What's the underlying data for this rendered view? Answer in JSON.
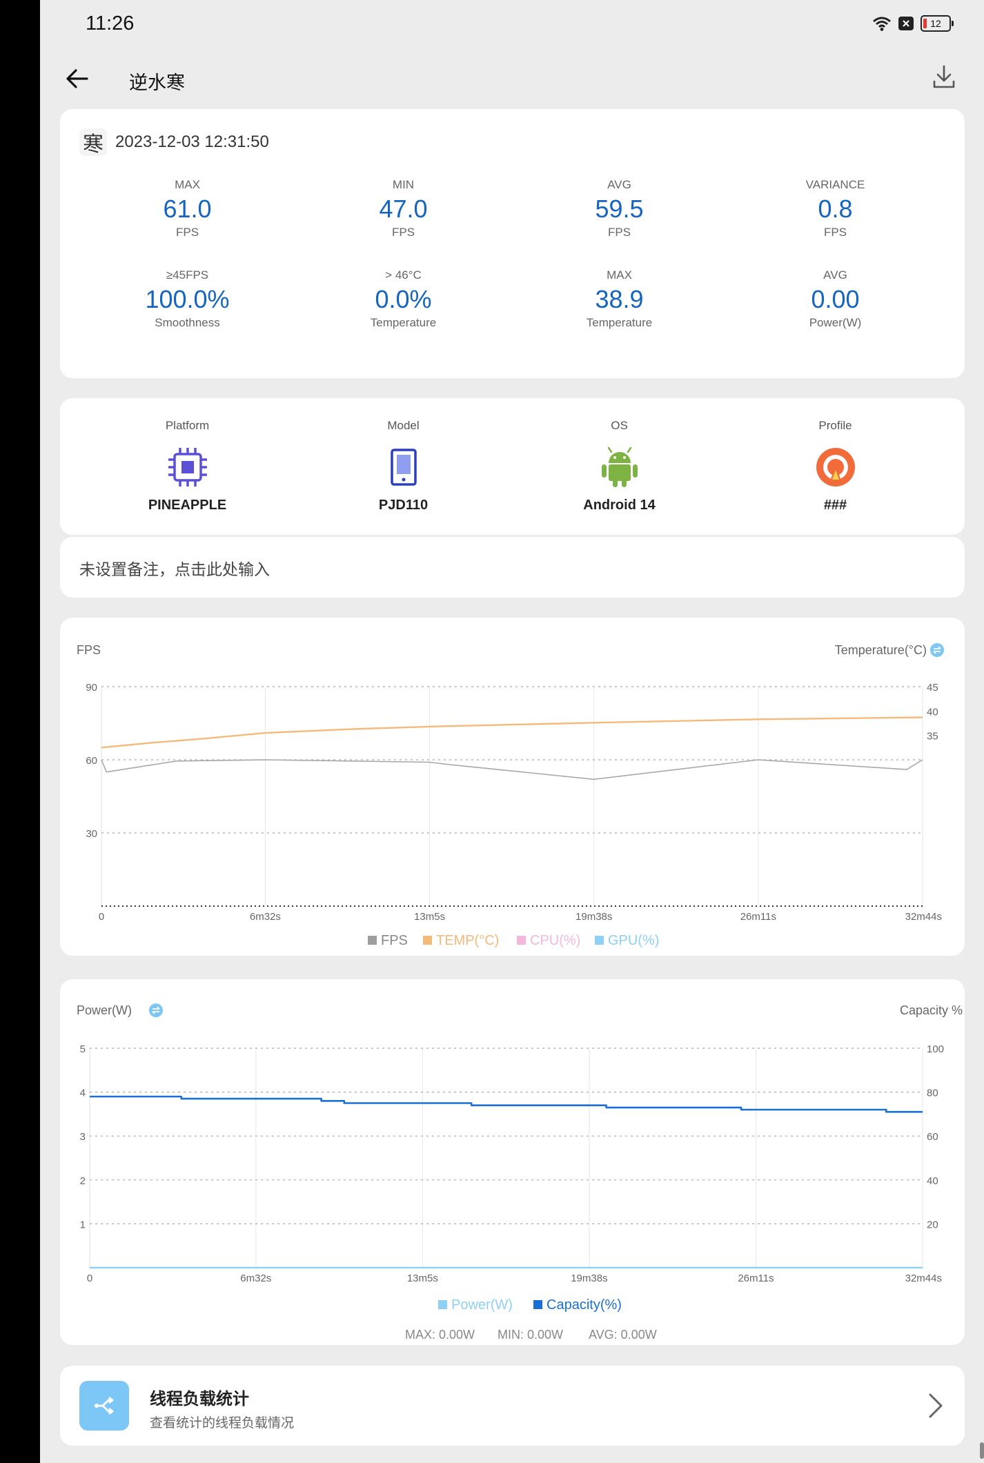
{
  "status_bar": {
    "time": "11:26",
    "battery": "12"
  },
  "app_bar": {
    "title": "逆水寒"
  },
  "session": {
    "game_icon_char": "寒",
    "timestamp": "2023-12-03 12:31:50",
    "stats": [
      {
        "top": "MAX",
        "value": "61.0",
        "bottom": "FPS"
      },
      {
        "top": "MIN",
        "value": "47.0",
        "bottom": "FPS"
      },
      {
        "top": "AVG",
        "value": "59.5",
        "bottom": "FPS"
      },
      {
        "top": "VARIANCE",
        "value": "0.8",
        "bottom": "FPS"
      },
      {
        "top": "≥45FPS",
        "value": "100.0%",
        "bottom": "Smoothness"
      },
      {
        "top": "> 46°C",
        "value": "0.0%",
        "bottom": "Temperature"
      },
      {
        "top": "MAX",
        "value": "38.9",
        "bottom": "Temperature"
      },
      {
        "top": "AVG",
        "value": "0.00",
        "bottom": "Power(W)"
      }
    ]
  },
  "device": {
    "items": [
      {
        "label": "Platform",
        "value": "PINEAPPLE",
        "icon": "chip-icon"
      },
      {
        "label": "Model",
        "value": "PJD110",
        "icon": "tablet-icon"
      },
      {
        "label": "OS",
        "value": "Android 14",
        "icon": "android-icon"
      },
      {
        "label": "Profile",
        "value": "###",
        "icon": "profile-icon"
      }
    ]
  },
  "note": {
    "placeholder": "未设置备注，点击此处输入"
  },
  "colors": {
    "accent": "#1565c0",
    "fps": "#9e9e9e",
    "temp": "#f5b97a",
    "cpu": "#f5b8dc",
    "gpu": "#8fd0f5",
    "power": "#8fd0f5",
    "capacity": "#1a6fd6"
  },
  "chart_data": [
    {
      "type": "line",
      "left_axis_label": "FPS",
      "right_axis_label": "Temperature(°C)",
      "x_ticks": [
        "0",
        "6m32s",
        "13m5s",
        "19m38s",
        "26m11s",
        "32m44s"
      ],
      "x_minutes": [
        0,
        6.53,
        13.08,
        19.63,
        26.18,
        32.73
      ],
      "y_left_ticks": [
        "90",
        "60",
        "30"
      ],
      "y_left_range": [
        0,
        90
      ],
      "y_right_ticks": [
        "45",
        "40",
        "35"
      ],
      "y_right_range": [
        0,
        45
      ],
      "legend": [
        "FPS",
        "TEMP(°C)",
        "CPU(%)",
        "GPU(%)"
      ],
      "series": [
        {
          "name": "FPS",
          "x": [
            0,
            0.2,
            3,
            6.53,
            13.08,
            13.9,
            19.63,
            26.18,
            32.1,
            32.73
          ],
          "y": [
            60,
            55,
            59.5,
            60,
            59,
            58,
            52,
            60,
            56,
            60
          ]
        },
        {
          "name": "TEMP(°C)",
          "x": [
            0,
            2,
            4,
            6.53,
            10,
            13.08,
            19.63,
            26.18,
            32.73
          ],
          "y": [
            32.5,
            33.5,
            34.3,
            35.5,
            36.3,
            36.8,
            37.6,
            38.3,
            38.7
          ]
        },
        {
          "name": "CPU(%)",
          "x": [],
          "y": []
        },
        {
          "name": "GPU(%)",
          "x": [],
          "y": []
        }
      ],
      "grid": true,
      "legend_position": "bottom"
    },
    {
      "type": "line",
      "left_axis_label": "Power(W)",
      "right_axis_label": "Capacity %",
      "x_ticks": [
        "0",
        "6m32s",
        "13m5s",
        "19m38s",
        "26m11s",
        "32m44s"
      ],
      "x_minutes": [
        0,
        6.53,
        13.08,
        19.63,
        26.18,
        32.73
      ],
      "y_left_ticks": [
        "5",
        "4",
        "3",
        "2",
        "1"
      ],
      "y_left_range": [
        0,
        5
      ],
      "y_right_ticks": [
        "100",
        "80",
        "60",
        "40",
        "20"
      ],
      "y_right_range": [
        0,
        100
      ],
      "legend": [
        "Power(W)",
        "Capacity(%)"
      ],
      "series": [
        {
          "name": "Power(W)",
          "x": [
            0,
            32.73
          ],
          "y": [
            0,
            0
          ]
        },
        {
          "name": "Capacity(%)",
          "x": [
            0,
            3.6,
            3.6,
            9.1,
            9.1,
            10,
            10,
            15,
            15,
            20.3,
            20.3,
            25.6,
            25.6,
            31.3,
            31.3,
            32.73
          ],
          "y": [
            78,
            78,
            77,
            77,
            76,
            76,
            75,
            75,
            74,
            74,
            73,
            73,
            72,
            72,
            71,
            71
          ]
        }
      ],
      "grid": true,
      "legend_position": "bottom",
      "summary": {
        "max": "MAX: 0.00W",
        "min": "MIN: 0.00W",
        "avg": "AVG: 0.00W"
      }
    }
  ],
  "thread_card": {
    "title": "线程负载统计",
    "subtitle": "查看统计的线程负载情况"
  }
}
